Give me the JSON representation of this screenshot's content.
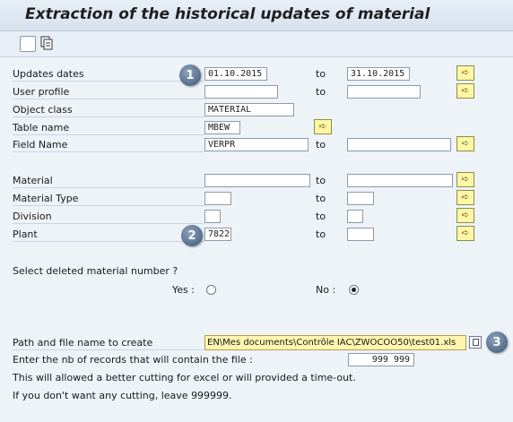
{
  "header": {
    "title": "Extraction of the historical updates of material"
  },
  "form": {
    "rows": [
      {
        "label": "Updates dates",
        "low": "01.10.2015",
        "to": "to",
        "high": "31.10.2015"
      },
      {
        "label": "User profile",
        "low": "",
        "to": "to",
        "high": ""
      },
      {
        "label": "Object class",
        "low": "MATERIAL"
      },
      {
        "label": "Table name",
        "low": "MBEW"
      },
      {
        "label": "Field Name",
        "low": "VERPR",
        "to": "to",
        "high": ""
      },
      {
        "label": "Material",
        "low": "",
        "to": "to",
        "high": ""
      },
      {
        "label": "Material Type",
        "low": "",
        "to": "to",
        "high": ""
      },
      {
        "label": "Division",
        "low": "",
        "to": "to",
        "high": ""
      },
      {
        "label": "Plant",
        "low": "7822",
        "to": "to",
        "high": ""
      }
    ],
    "deleted": {
      "question": "Select deleted material number ?",
      "yes_label": "Yes :",
      "no_label": "No :",
      "selected": "no"
    },
    "path": {
      "label": "Path and file name to create",
      "value": "EN\\Mes documents\\Contrôle IAC\\ZWOCOO50\\test01.xls"
    },
    "records": {
      "label": "Enter the nb of records that will contain the file :",
      "value": "999 999"
    },
    "notes": [
      "This will allowed a better cutting for excel or will provided a time-out.",
      "If you don't want any cutting, leave 999999."
    ]
  },
  "callouts": [
    "1",
    "2",
    "3"
  ],
  "icons": {
    "multiple_selection": "arrow-right-icon",
    "field_name_selection": "green-arrow-right-icon",
    "toolbar_1": "checkbox-icon",
    "toolbar_2": "copy-document-icon"
  },
  "colors": {
    "background": "#eef3f8",
    "selection_button": "#fff6a8",
    "path_field": "#fff6b0",
    "callout_badge": "#3e5677"
  }
}
